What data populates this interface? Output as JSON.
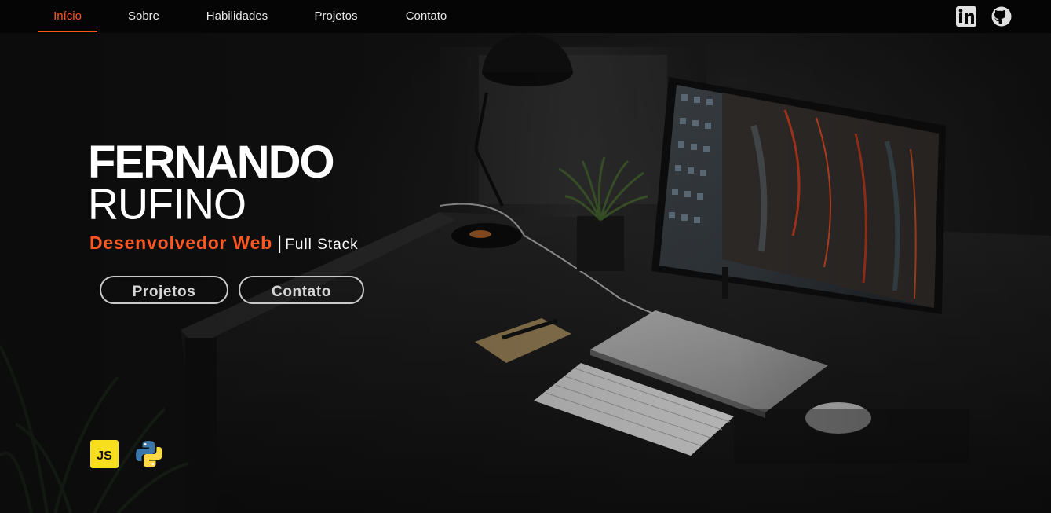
{
  "nav": {
    "items": [
      {
        "label": "Início",
        "active": true
      },
      {
        "label": "Sobre",
        "active": false
      },
      {
        "label": "Habilidades",
        "active": false
      },
      {
        "label": "Projetos",
        "active": false
      },
      {
        "label": "Contato",
        "active": false
      }
    ],
    "social": [
      {
        "icon": "linkedin-icon"
      },
      {
        "icon": "github-icon"
      }
    ]
  },
  "hero": {
    "first_name": "FERNANDO",
    "last_name": "RUFINO",
    "role": "Desenvolvedor Web",
    "separator": "|",
    "stack": "Full Stack",
    "buttons": [
      "Projetos",
      "Contato"
    ],
    "tech_icons": [
      {
        "icon": "javascript-icon",
        "label": "JS"
      },
      {
        "icon": "python-icon"
      }
    ]
  },
  "colors": {
    "accent": "#ff5722",
    "nav_bg": "#050505",
    "text": "#ffffff",
    "js_yellow": "#f7df1e",
    "python_blue": "#3b77a8",
    "python_yellow": "#ffd845"
  }
}
